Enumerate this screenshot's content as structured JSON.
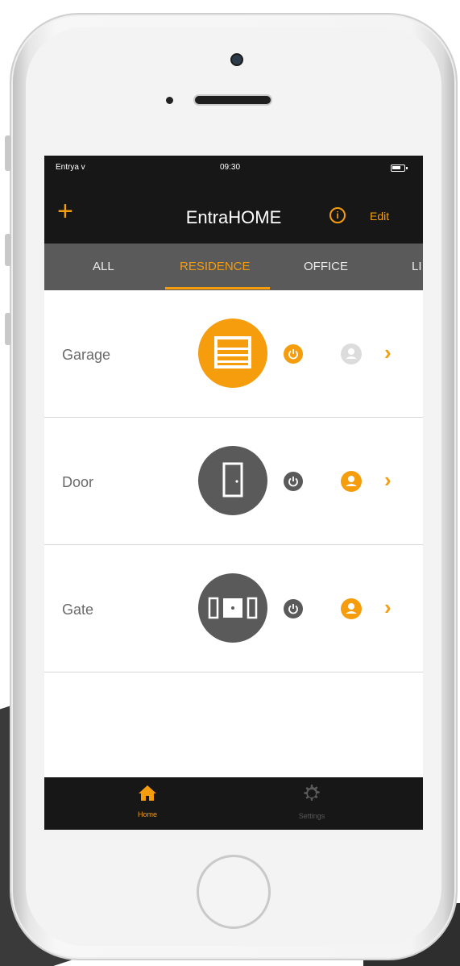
{
  "status_bar": {
    "carrier": "Entrya ᴠ",
    "time": "09:30"
  },
  "nav": {
    "add_label": "+",
    "title": "EntraHOME",
    "info_label": "i",
    "edit_label": "Edit"
  },
  "tabs": [
    {
      "label": "ALL"
    },
    {
      "label": "RESIDENCE"
    },
    {
      "label": "OFFICE"
    },
    {
      "label": "LI"
    }
  ],
  "devices": [
    {
      "label": "Garage",
      "icon": "garage-door-icon",
      "active": true
    },
    {
      "label": "Door",
      "icon": "door-icon",
      "active": false
    },
    {
      "label": "Gate",
      "icon": "gate-icon",
      "active": false
    }
  ],
  "bottom_nav": [
    {
      "label": "Home",
      "icon": "home-icon"
    },
    {
      "label": "Settings",
      "icon": "gear-icon"
    }
  ],
  "colors": {
    "accent": "#f59d0d",
    "dark": "#171717",
    "tab_bg": "#5a5a5a",
    "icon_grey": "#5a5a5a"
  }
}
